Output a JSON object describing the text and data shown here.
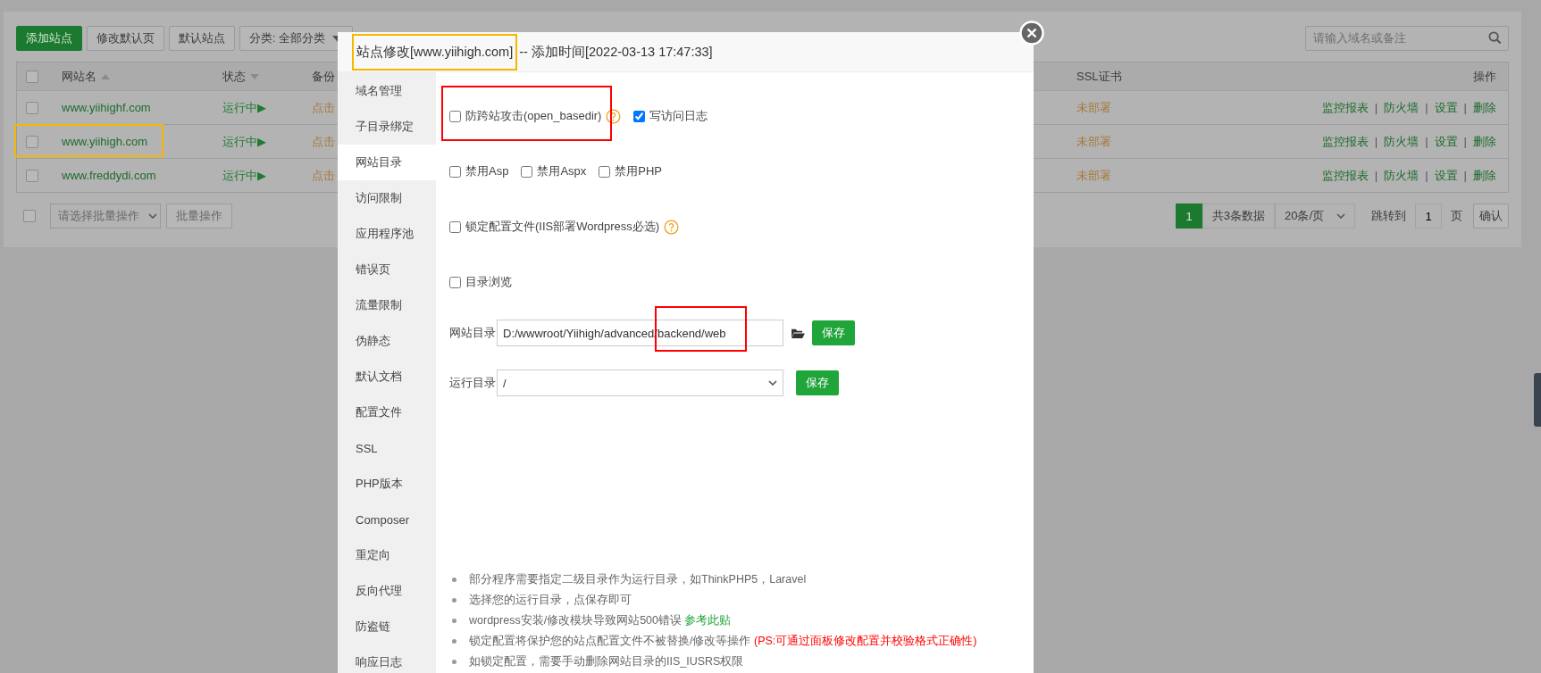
{
  "toolbar": {
    "buttons": [
      {
        "label": "添加站点",
        "kind": "primary"
      },
      {
        "label": "修改默认页",
        "kind": "default"
      },
      {
        "label": "默认站点",
        "kind": "default"
      }
    ],
    "category_dropdown": "分类: 全部分类",
    "search": {
      "placeholder": "请输入域名或备注"
    }
  },
  "table": {
    "all_checked": false,
    "columns": [
      {
        "label": "网站名",
        "kind": "ascending"
      },
      {
        "label": "状态",
        "kind": "descending"
      },
      {
        "label": "备份",
        "kind": "plain"
      },
      {
        "label": "SSL证书",
        "kind": "plain"
      },
      {
        "label": "操作",
        "kind": "plain"
      }
    ],
    "rows": [
      {
        "checked": false,
        "highlighted": false,
        "name": "www.yiihighf.com",
        "status": "运行中▶",
        "backup": "点击",
        "ssl": "未部署",
        "actions": [
          {
            "label": "监控报表",
            "kind": "link"
          },
          {
            "label": "|",
            "kind": "separator"
          },
          {
            "label": "防火墙",
            "kind": "link"
          },
          {
            "label": "|",
            "kind": "separator"
          },
          {
            "label": "设置",
            "kind": "link"
          },
          {
            "label": "|",
            "kind": "separator"
          },
          {
            "label": "删除",
            "kind": "link"
          }
        ]
      },
      {
        "checked": false,
        "highlighted": true,
        "name": "www.yiihigh.com",
        "status": "运行中▶",
        "backup": "点击",
        "ssl": "未部署",
        "actions": [
          {
            "label": "监控报表",
            "kind": "link"
          },
          {
            "label": "|",
            "kind": "separator"
          },
          {
            "label": "防火墙",
            "kind": "link"
          },
          {
            "label": "|",
            "kind": "separator"
          },
          {
            "label": "设置",
            "kind": "link"
          },
          {
            "label": "|",
            "kind": "separator"
          },
          {
            "label": "删除",
            "kind": "link"
          }
        ]
      },
      {
        "checked": false,
        "highlighted": false,
        "name": "www.freddydi.com",
        "status": "运行中▶",
        "backup": "点击",
        "ssl": "未部署",
        "actions": [
          {
            "label": "监控报表",
            "kind": "link"
          },
          {
            "label": "|",
            "kind": "separator"
          },
          {
            "label": "防火墙",
            "kind": "link"
          },
          {
            "label": "|",
            "kind": "separator"
          },
          {
            "label": "设置",
            "kind": "link"
          },
          {
            "label": "|",
            "kind": "separator"
          },
          {
            "label": "删除",
            "kind": "link"
          }
        ]
      }
    ]
  },
  "footer": {
    "batch_checked": false,
    "batch_select": "请选择批量操作",
    "batch_button": "批量操作",
    "pagination": {
      "current_page": "1",
      "total": "共3条数据",
      "page_size": "20条/页",
      "jump_label": "跳转到",
      "jump_value": "1",
      "page_unit": "页",
      "confirm": "确认"
    }
  },
  "modal": {
    "title": "站点修改[www.yiihigh.com]",
    "title_highlighted": true,
    "subtitle": "-- 添加时间[2022-03-13 17:47:33]",
    "sidebar": [
      {
        "label": "域名管理",
        "selected": false
      },
      {
        "label": "子目录绑定",
        "selected": false
      },
      {
        "label": "网站目录",
        "selected": true
      },
      {
        "label": "访问限制",
        "selected": false
      },
      {
        "label": "应用程序池",
        "selected": false
      },
      {
        "label": "错误页",
        "selected": false
      },
      {
        "label": "流量限制",
        "selected": false
      },
      {
        "label": "伪静态",
        "selected": false
      },
      {
        "label": "默认文档",
        "selected": false
      },
      {
        "label": "配置文件",
        "selected": false
      },
      {
        "label": "SSL",
        "selected": false
      },
      {
        "label": "PHP版本",
        "selected": false
      },
      {
        "label": "Composer",
        "selected": false
      },
      {
        "label": "重定向",
        "selected": false
      },
      {
        "label": "反向代理",
        "selected": false
      },
      {
        "label": "防盗链",
        "selected": false
      },
      {
        "label": "响应日志",
        "selected": false
      }
    ],
    "option_rows": [
      [
        {
          "label": "防跨站攻击(open_basedir)",
          "checked": false,
          "help": true,
          "highlighted": true
        },
        {
          "label": "写访问日志",
          "checked": true,
          "help": false,
          "highlighted": false
        }
      ],
      [
        {
          "label": "禁用Asp",
          "checked": false,
          "help": false,
          "highlighted": false
        },
        {
          "label": "禁用Aspx",
          "checked": false,
          "help": false,
          "highlighted": false
        },
        {
          "label": "禁用PHP",
          "checked": false,
          "help": false,
          "highlighted": false
        }
      ],
      [
        {
          "label": "锁定配置文件(IIS部署Wordpress必选)",
          "checked": false,
          "help": true,
          "highlighted": false
        }
      ],
      [
        {
          "label": "目录浏览",
          "checked": false,
          "help": false,
          "highlighted": false
        }
      ]
    ],
    "site_dir": {
      "label": "网站目录",
      "value": "D:/wwwroot/Yiihigh/advanced/backend/web",
      "value_highlighted": true,
      "save": "保存"
    },
    "run_dir": {
      "label": "运行目录",
      "value": "/",
      "save": "保存"
    },
    "notes": [
      {
        "text": "部分程序需要指定二级目录作为运行目录，如ThinkPHP5，Laravel"
      },
      {
        "text": "选择您的运行目录，点保存即可"
      },
      {
        "text": "wordpress安装/修改模块导致网站500错误",
        "link": "参考此贴"
      },
      {
        "text": "锁定配置将保护您的站点配置文件不被替换/修改等操作",
        "warning": "(PS:可通过面板修改配置并校验格式正确性)"
      },
      {
        "text": "如锁定配置，需要手动删除网站目录的IIS_IUSRS权限"
      }
    ]
  }
}
